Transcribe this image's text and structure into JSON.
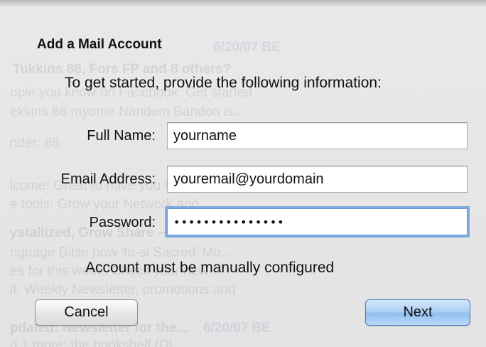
{
  "window": {
    "title": "Add a Mail Account",
    "subtitle": "To get started, provide the following information:"
  },
  "form": {
    "full_name": {
      "label": "Full Name:",
      "value": "yourname"
    },
    "email": {
      "label": "Email Address:",
      "value": "youremail@yourdomain"
    },
    "password": {
      "label": "Password:",
      "value": "•••••••••••••••"
    }
  },
  "status_text": "Account must be manually configured",
  "buttons": {
    "cancel": "Cancel",
    "next": "Next"
  },
  "background_text": {
    "date1": "6/20/07 BE",
    "line1": "Tukkins 88, Fors FP and 8 others?",
    "line2": "ople you know on Facebook. Get started",
    "line3": "ekkins 88 myome Nandem Bandon is...",
    "line4": "nder: 88",
    "line5": "lcome! Great to have you here.",
    "line6": "e tools: Grow your Network and",
    "line7": "ystallized, Grow Share — the latest on",
    "line8": "nguage Bible now 'tu-si Sacred' Mo...",
    "line9": "es for this week: Check your new",
    "line10": "lt, Weekly Newsletter, promotions and",
    "line11": "pdated: Newsletter for the...",
    "date2": "6/20/07 BE",
    "line12": "d 1 more: the bookshelf (Di..."
  },
  "colors": {
    "focus_ring": "#6ea0e6",
    "default_button": "#a9cdf4"
  }
}
